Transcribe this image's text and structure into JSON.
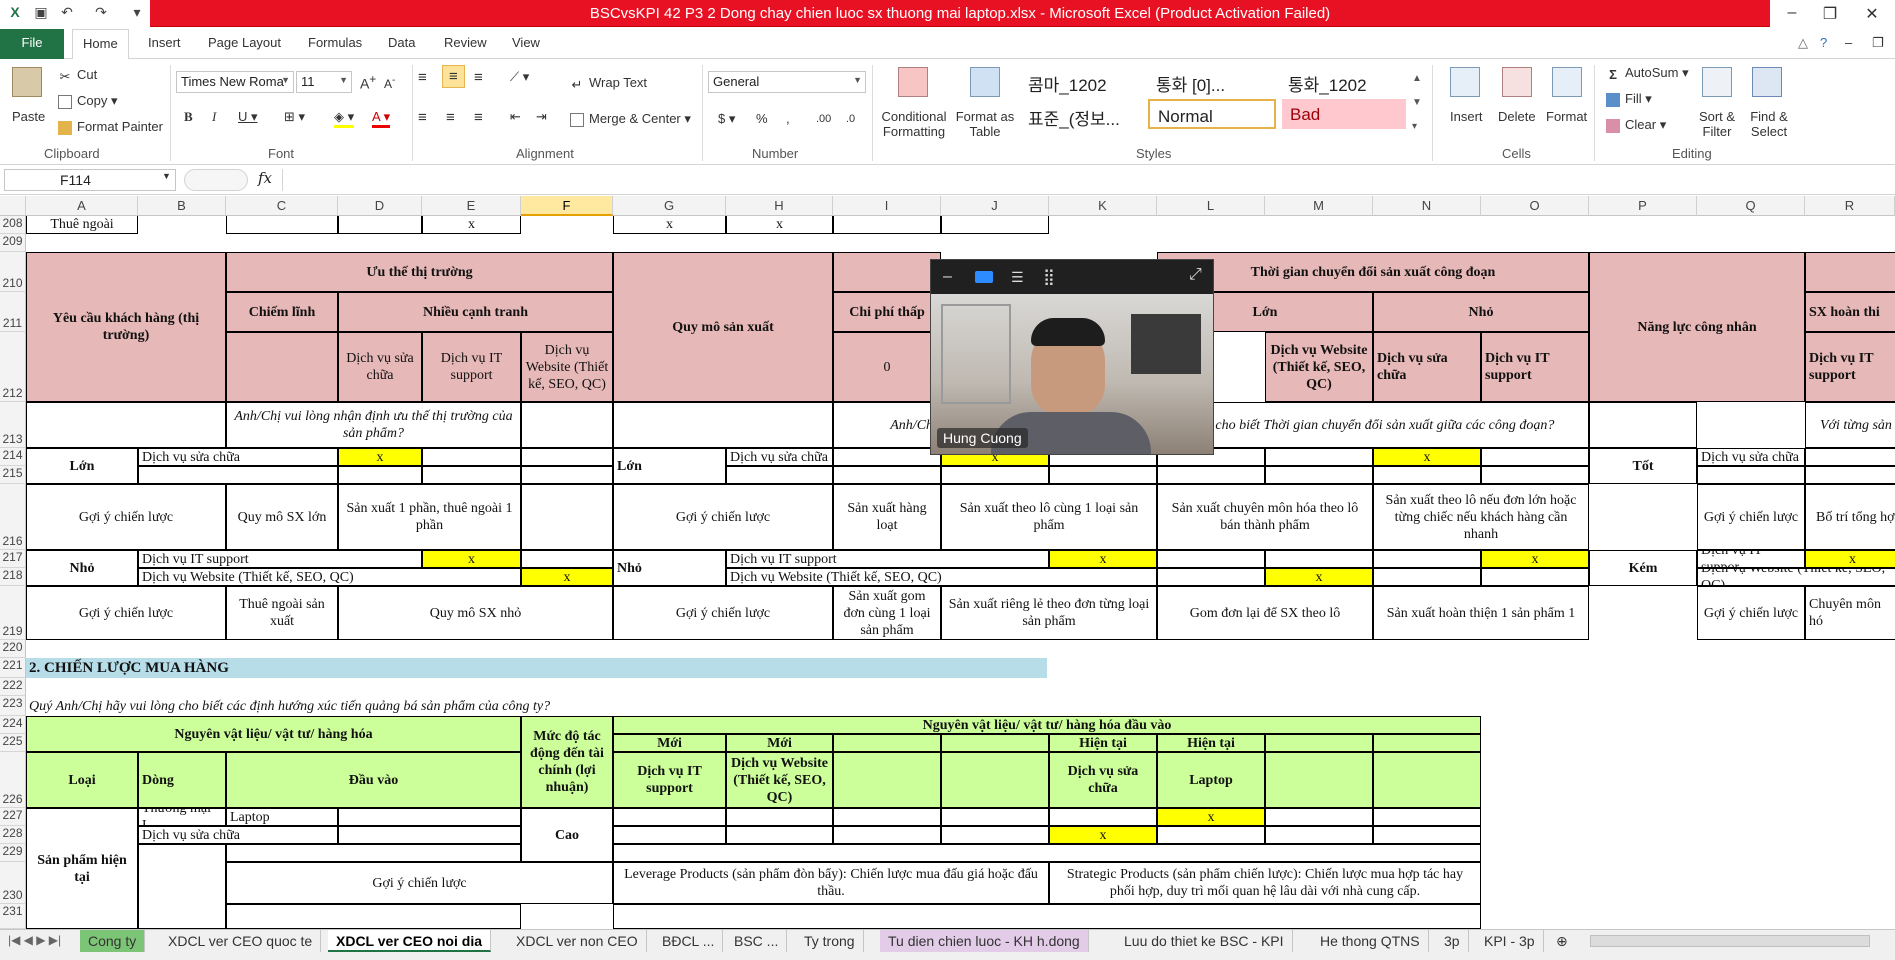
{
  "window": {
    "title": "BSCvsKPI 42 P3 2 Dong chay chien luoc sx thuong mai laptop.xlsx  -  Microsoft Excel (Product Activation Failed)"
  },
  "tabs": [
    "File",
    "Home",
    "Insert",
    "Page Layout",
    "Formulas",
    "Data",
    "Review",
    "View"
  ],
  "ribbon": {
    "clipboard": {
      "paste": "Paste",
      "cut": "Cut",
      "copy": "Copy",
      "format_painter": "Format Painter",
      "label": "Clipboard"
    },
    "font": {
      "name": "Times New Roma",
      "size": "11",
      "label": "Font"
    },
    "alignment": {
      "wrap": "Wrap Text",
      "merge": "Merge & Center",
      "label": "Alignment"
    },
    "number": {
      "format": "General",
      "label": "Number"
    },
    "styles": {
      "conditional": "Conditional Formatting",
      "format_table": "Format as Table",
      "cells": [
        "콤마_1202",
        "통화 [0]...",
        "통화_1202",
        "표준_(정보...",
        "Normal",
        "Bad"
      ],
      "label": "Styles"
    },
    "cells": {
      "insert": "Insert",
      "delete": "Delete",
      "format": "Format",
      "label": "Cells"
    },
    "editing": {
      "autosum": "AutoSum",
      "fill": "Fill",
      "clear": "Clear",
      "sort": "Sort & Filter",
      "find": "Find & Select",
      "label": "Editing"
    }
  },
  "formula_bar": {
    "name_box": "F114",
    "fx": "fx",
    "formula": ""
  },
  "columns": [
    "A",
    "B",
    "C",
    "D",
    "E",
    "F",
    "G",
    "H",
    "I",
    "J",
    "K",
    "L",
    "M",
    "N",
    "O",
    "P",
    "Q",
    "R"
  ],
  "rows": [
    "208",
    "209",
    "210",
    "211",
    "212",
    "213",
    "214",
    "215",
    "216",
    "217",
    "218",
    "219",
    "220",
    "221",
    "222",
    "223",
    "224",
    "225",
    "226",
    "227",
    "228",
    "229",
    "230",
    "231"
  ],
  "cells": {
    "r208a": "Thuê ngoài",
    "r208e": "x",
    "r208g": "x",
    "r208h": "x",
    "req": "Yêu cầu khách hàng (thị trường)",
    "uu_the": "Ưu thế thị trường",
    "chiem_linh": "Chiếm lĩnh",
    "nhieu_canh_tranh": "Nhiều cạnh tranh",
    "dv_sua_chua": "Dịch vụ sửa chữa",
    "dv_it": "Dịch vụ IT support",
    "dv_web": "Dịch vụ Website (Thiết kế, SEO, QC)",
    "quy_mo": "Quy mô sản xuất",
    "chi_phi_trunc": "Chi phí thấp",
    "zero": "0",
    "thoi_gian": "Thời gian chuyển đổi sản xuất công đoạn",
    "lon": "Lớn",
    "nho": "Nhỏ",
    "nang_luc": "Năng lực công nhân",
    "sx_hoan_thien": "SX hoàn thi",
    "dv_web_m": "Dịch vụ Website (Thiết kế, SEO, QC)",
    "dv_sua_chua_n": "Dịch vụ sửa chữa",
    "dv_it_o": "Dịch vụ IT support",
    "dv_it_r": "Dịch vụ IT support",
    "q213": "Anh/Chị vui lòng nhận định ưu thế thị trường của sản phẩm?",
    "q213b": "Anh/Chị vui l chiế",
    "q213c": "hãy cho biết Thời gian chuyển đổi sản xuất giữa các công đoạn?",
    "q213d": "Với từng sản",
    "x": "x",
    "tot": "Tốt",
    "kem": "Kém",
    "goi_y": "Gợi ý chiến lược",
    "qm_sx_lon": "Quy mô SX lớn",
    "sx_1phan": "Sản xuất 1 phần, thuê ngoài 1 phần",
    "sx_hang_loat": "Sản xuất hàng loạt",
    "sx_theo_lo": "Sản xuất theo lô cùng 1 loại sản phẩm",
    "sx_chuyen_mon": "Sản xuất chuyên môn hóa theo lô bán thành phẩm",
    "sx_theo_lo_don": "Sản xuất theo lô nếu đơn lớn hoặc từng chiếc nếu khách hàng cần nhanh",
    "bo_tri": "Bố trí tổng hợ",
    "thue_ngoai_sx": "Thuê ngoài sản xuất",
    "qm_sx_nho": "Quy mô SX nhỏ",
    "sx_gom": "Sản xuất gom đơn cùng 1 loại sản phẩm",
    "sx_rieng": "Sản xuất riêng lẻ theo đơn từng loại sản phẩm",
    "gom_don": "Gom đơn lại để SX theo lô",
    "sx_hoan_thien_1": "Sản xuất hoàn thiện 1 sản phẩm 1",
    "chuyen_mon": "Chuyên môn hó",
    "dv_it_q": "Dịch vụ IT suppor",
    "dv_web_q": "Dịch vụ Website (Thiết kế, SEO, QC)",
    "dv_sua_chua_q": "Dịch vụ sửa chữa",
    "sec2": "2. CHIẾN LƯỢC MUA HÀNG",
    "q223": "Quý Anh/Chị hãy vui lòng cho biết các định hướng xúc tiến quảng bá sản phẩm của công ty?",
    "nvl": "Nguyên vật liệu/ vật tư/ hàng hóa",
    "muc_do": "Mức độ tác động đến tài chính (lợi nhuận)",
    "nvl_dau_vao": "Nguyên vật liệu/ vật tư/ hàng hóa đầu vào",
    "moi": "Mới",
    "hien_tai": "Hiện tại",
    "loai": "Loại",
    "dong": "Dòng",
    "dau_vao": "Đầu vào",
    "laptop": "Laptop",
    "tm_laptop": "Thương mại L",
    "cao": "Cao",
    "sp_hien_tai": "Sản phẩm hiện tại",
    "leverage": "Leverage Products (sản phẩm đòn bẩy): Chiến lược mua đấu giá hoặc đấu thầu.",
    "strategic": "Strategic Products (sản phẩm chiến lược): Chiến lược mua hợp tác hay phối hợp, duy trì mối quan hệ lâu dài với nhà cung cấp."
  },
  "video": {
    "participant": "Hung Cuong"
  },
  "sheet_tabs": [
    "Cong ty",
    "XDCL ver CEO quoc te",
    "XDCL ver CEO noi dia",
    "XDCL ver non CEO",
    "BĐCL ...",
    "BSC ...",
    "Ty trong",
    "Tu dien chien luoc - KH h.dong",
    "Luu do thiet ke BSC - KPI",
    "He thong QTNS",
    "3p",
    "KPI - 3p"
  ],
  "colors": {
    "accent": "#217346",
    "title_bar": "#e81123",
    "header_pink": "#e6b8b7",
    "header_green": "#ccff99",
    "mark_yellow": "#ffff00",
    "section_blue": "#b7dde8"
  }
}
